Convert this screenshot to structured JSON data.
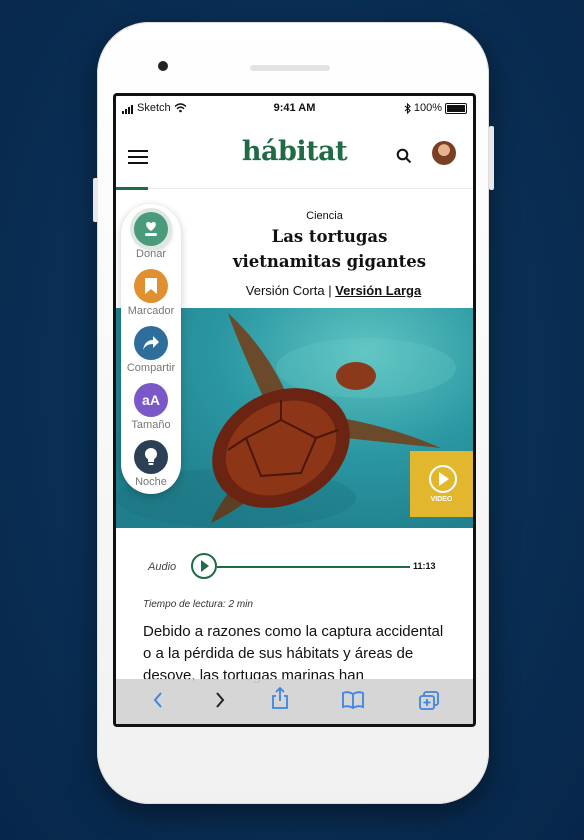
{
  "colors": {
    "brand": "#1f6b46",
    "video_accent": "#e3b72d",
    "background": "#0a2f55"
  },
  "status_bar": {
    "carrier": "Sketch",
    "time": "9:41 AM",
    "battery": "100%"
  },
  "header": {
    "logo": "hábitat",
    "menu_icon": "hamburger-menu-icon",
    "search_icon": "search-icon",
    "avatar_icon": "user-avatar"
  },
  "article": {
    "category": "Ciencia",
    "title_line1": "Las tortugas",
    "title_line2": "vietnamitas gigantes",
    "version_short": "Versión Corta",
    "separator": "|",
    "version_long": "Versión Larga",
    "video_label": "VIDEO",
    "reading_time": "Tiempo de lectura: 2 min",
    "body_text": "Debido a razones como la captura accidental o a la pérdida de sus hábitats y áreas de desove, las tortugas marinas han"
  },
  "sidebar": {
    "items": [
      {
        "label": "Donar",
        "icon": "donate-heart-hand-icon",
        "color": "#4a9a7c"
      },
      {
        "label": "Marcador",
        "icon": "bookmark-icon",
        "color": "#e0902f"
      },
      {
        "label": "Compartir",
        "icon": "share-arrow-icon",
        "color": "#2e6e9a"
      },
      {
        "label": "Tamaño",
        "icon": "font-size-icon",
        "color": "#7a58c8",
        "glyph": "aA"
      },
      {
        "label": "Noche",
        "icon": "night-lightbulb-icon",
        "color": "#2b3f55"
      }
    ]
  },
  "audio": {
    "label": "Audio",
    "duration": "11:13",
    "progress": 0
  },
  "browser_toolbar": {
    "icons": [
      "back-icon",
      "forward-icon",
      "share-icon",
      "bookmarks-icon",
      "tabs-icon"
    ]
  }
}
